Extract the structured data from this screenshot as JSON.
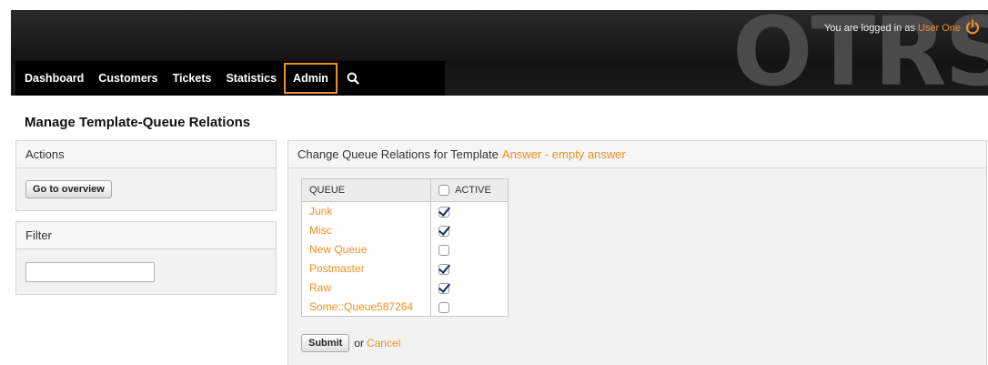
{
  "header": {
    "logo": "OTRS",
    "login_prefix": "You are logged in as ",
    "user_name": "User One"
  },
  "nav": {
    "items": [
      "Dashboard",
      "Customers",
      "Tickets",
      "Statistics",
      "Admin"
    ],
    "active": "Admin"
  },
  "page": {
    "title": "Manage Template-Queue Relations"
  },
  "sidebar": {
    "actions_title": "Actions",
    "overview_button": "Go to overview",
    "filter_title": "Filter",
    "filter_value": ""
  },
  "main": {
    "heading_prefix": "Change Queue Relations for Template ",
    "template_name": "Answer - empty answer",
    "col_queue": "QUEUE",
    "col_active": "ACTIVE",
    "rows": [
      {
        "queue": "Junk",
        "active": true
      },
      {
        "queue": "Misc",
        "active": true
      },
      {
        "queue": "New Queue",
        "active": false
      },
      {
        "queue": "Postmaster",
        "active": true
      },
      {
        "queue": "Raw",
        "active": true
      },
      {
        "queue": "Some::Queue587264",
        "active": false
      }
    ],
    "submit_label": "Submit",
    "or_label": "or",
    "cancel_label": "Cancel"
  },
  "colors": {
    "accent": "#f08f1f",
    "header_bg": "#1a1a1a"
  }
}
